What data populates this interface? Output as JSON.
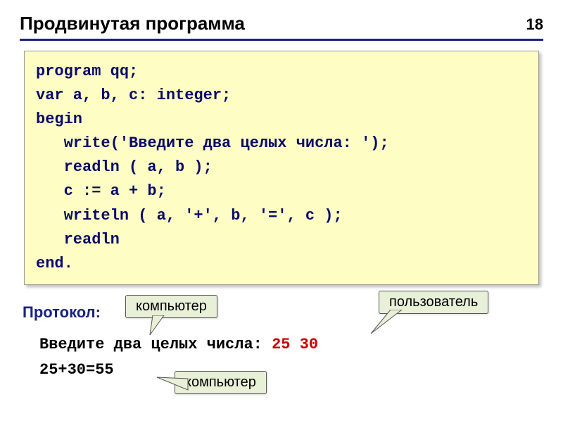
{
  "header": {
    "title": "Продвинутая программа",
    "page_number": "18"
  },
  "code": {
    "line1": "program qq;",
    "line2": "var a, b, c: integer;",
    "line3": "begin",
    "line4": "   write('Введите два целых числа: ');",
    "line5": "   readln ( a, b );",
    "line6": "   c := a + b;",
    "line7": "   writeln ( a, '+', b, '=', c );",
    "line8": "   readln",
    "line9": "end."
  },
  "protocol": {
    "label": "Протокол:",
    "callout_computer": "компьютер",
    "callout_user": "пользователь",
    "prompt_text": "Введите два целых числа:",
    "input_text": "25 30",
    "result_text": "25+30=55"
  }
}
